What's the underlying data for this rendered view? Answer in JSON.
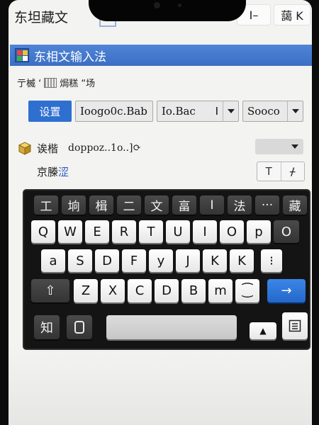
{
  "app": {
    "title": "东坦藏文",
    "top_button_1": "I–",
    "top_button_2": "藹 K"
  },
  "header": {
    "title": "东相文输入法",
    "subtitle_left": "亍楲 ‘",
    "subtitle_right": "焗糕 “场"
  },
  "controls": {
    "settings_label": "设置",
    "combo_1_value": "Ioogo0c.Bab",
    "combo_2_value": "Io.Bac",
    "combo_2_mark": "I",
    "combo_3_value": "Sooco"
  },
  "field": {
    "label": "诶楷",
    "value": "doppoz..1o..]⟳"
  },
  "row2": {
    "label": "京榺",
    "label_accent": "涩",
    "seg_left": "T",
    "seg_right": "ᚋ"
  },
  "keyboard": {
    "candidates": [
      "工",
      "垧",
      "楫",
      "二",
      "文",
      "畗",
      "I",
      "法",
      "···",
      "藏"
    ],
    "row1": [
      "Q",
      "W",
      "E",
      "R",
      "T",
      "U",
      "I",
      "O",
      "p",
      "O"
    ],
    "row2": [
      "a",
      "S",
      "D",
      "F",
      "y",
      "J",
      "K",
      "K",
      "⁝"
    ],
    "row3": [
      "⇧",
      "Z",
      "X",
      "C",
      "D",
      "B",
      "m",
      "⁐",
      "→"
    ],
    "row4": {
      "lang_key": "知",
      "copy_icon": "copy-icon",
      "up_icon": "▲",
      "menu_icon": "menu-icon"
    }
  }
}
